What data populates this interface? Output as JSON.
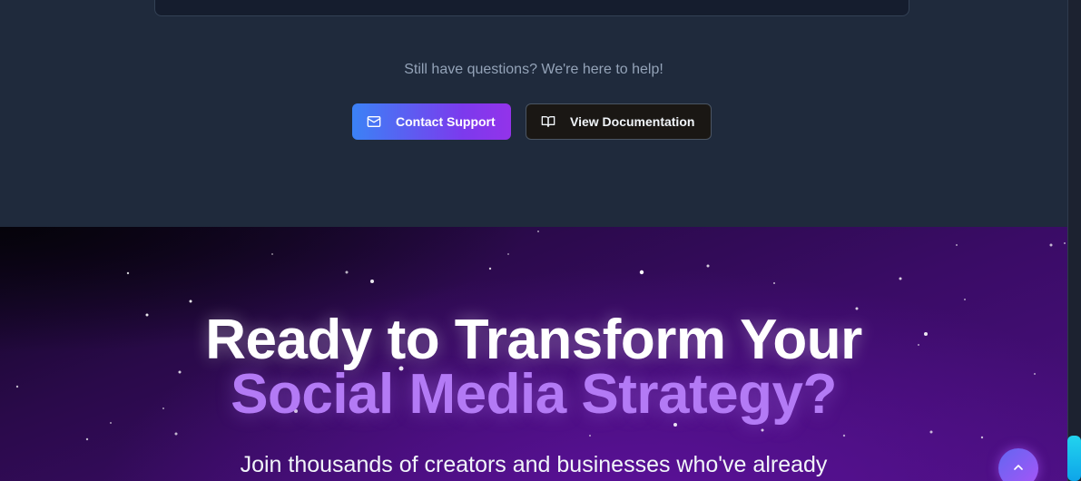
{
  "faq": {
    "help_text": "Still have questions? We're here to help!",
    "contact_label": "Contact Support",
    "docs_label": "View Documentation"
  },
  "cta": {
    "headline_line1": "Ready to Transform Your",
    "headline_line2": "Social Media Strategy?",
    "subline": "Join thousands of creators and businesses who've already"
  },
  "icons": {
    "contact": "mail-icon",
    "docs": "book-open-icon",
    "scroll_top": "chevron-up-icon"
  },
  "colors": {
    "faq_bg": "#1f2a3c",
    "contact_gradient_start": "#3b82f6",
    "contact_gradient_end": "#9333ea",
    "headline_accent": "#b37af5",
    "cta_bg": "#3a0c66"
  }
}
